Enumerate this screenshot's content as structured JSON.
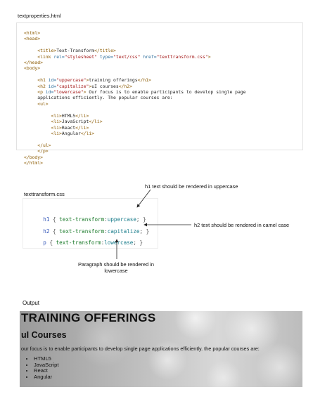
{
  "html_file": {
    "title": "textproperties.html",
    "lines": [
      {
        "indent": 0,
        "parts": [
          {
            "t": "<html>",
            "c": "tag"
          }
        ]
      },
      {
        "indent": 0,
        "parts": [
          {
            "t": "<head>",
            "c": "tag"
          }
        ]
      },
      {
        "indent": 0,
        "parts": [
          {
            "t": "",
            "c": "txt"
          }
        ]
      },
      {
        "indent": 5,
        "parts": [
          {
            "t": "<title>",
            "c": "tag"
          },
          {
            "t": "Text-Transform",
            "c": "txt"
          },
          {
            "t": "</title>",
            "c": "tag"
          }
        ]
      },
      {
        "indent": 5,
        "parts": [
          {
            "t": "<link ",
            "c": "tag"
          },
          {
            "t": "rel=",
            "c": "attr"
          },
          {
            "t": "\"stylesheet\"",
            "c": "str"
          },
          {
            "t": " type=",
            "c": "attr"
          },
          {
            "t": "\"text/css\"",
            "c": "str"
          },
          {
            "t": " href=",
            "c": "attr"
          },
          {
            "t": "\"texttransform.css\"",
            "c": "str"
          },
          {
            "t": ">",
            "c": "tag"
          }
        ]
      },
      {
        "indent": 0,
        "parts": [
          {
            "t": "</head>",
            "c": "tag"
          }
        ]
      },
      {
        "indent": 0,
        "parts": [
          {
            "t": "<body>",
            "c": "tag"
          }
        ]
      },
      {
        "indent": 0,
        "parts": [
          {
            "t": "",
            "c": "txt"
          }
        ]
      },
      {
        "indent": 5,
        "parts": [
          {
            "t": "<h1 ",
            "c": "tag"
          },
          {
            "t": "id=",
            "c": "attr"
          },
          {
            "t": "\"uppercase\"",
            "c": "str"
          },
          {
            "t": ">",
            "c": "tag"
          },
          {
            "t": "training offerings",
            "c": "txt"
          },
          {
            "t": "</h1>",
            "c": "tag"
          }
        ]
      },
      {
        "indent": 5,
        "parts": [
          {
            "t": "<h2 ",
            "c": "tag"
          },
          {
            "t": "id=",
            "c": "attr"
          },
          {
            "t": "\"capitalize\"",
            "c": "str"
          },
          {
            "t": ">",
            "c": "tag"
          },
          {
            "t": "uI courses",
            "c": "txt"
          },
          {
            "t": "</h2>",
            "c": "tag"
          }
        ]
      },
      {
        "indent": 5,
        "parts": [
          {
            "t": "<p ",
            "c": "tag"
          },
          {
            "t": "id=",
            "c": "attr"
          },
          {
            "t": "\"lowercase\"",
            "c": "str"
          },
          {
            "t": ">",
            "c": "tag"
          },
          {
            "t": " Our focus is to enable participants to develop single page",
            "c": "txt"
          }
        ]
      },
      {
        "indent": 5,
        "parts": [
          {
            "t": "applications efficiently. The popular courses are:",
            "c": "txt"
          }
        ]
      },
      {
        "indent": 5,
        "parts": [
          {
            "t": "<ul>",
            "c": "tag"
          }
        ]
      },
      {
        "indent": 0,
        "parts": [
          {
            "t": "",
            "c": "txt"
          }
        ]
      },
      {
        "indent": 10,
        "parts": [
          {
            "t": "<li>",
            "c": "tag"
          },
          {
            "t": "HTML5",
            "c": "txt"
          },
          {
            "t": "</li>",
            "c": "tag"
          }
        ]
      },
      {
        "indent": 10,
        "parts": [
          {
            "t": "<li>",
            "c": "tag"
          },
          {
            "t": "JavaScript",
            "c": "txt"
          },
          {
            "t": "</li>",
            "c": "tag"
          }
        ]
      },
      {
        "indent": 10,
        "parts": [
          {
            "t": "<li>",
            "c": "tag"
          },
          {
            "t": "React",
            "c": "txt"
          },
          {
            "t": "</li>",
            "c": "tag"
          }
        ]
      },
      {
        "indent": 10,
        "parts": [
          {
            "t": "<li>",
            "c": "tag"
          },
          {
            "t": "Angular",
            "c": "txt"
          },
          {
            "t": "</li>",
            "c": "tag"
          }
        ]
      },
      {
        "indent": 0,
        "parts": [
          {
            "t": "",
            "c": "txt"
          }
        ]
      },
      {
        "indent": 5,
        "parts": [
          {
            "t": "</ul>",
            "c": "tag"
          }
        ]
      },
      {
        "indent": 5,
        "parts": [
          {
            "t": "</p>",
            "c": "tag"
          }
        ]
      },
      {
        "indent": 0,
        "parts": [
          {
            "t": "</body>",
            "c": "tag"
          }
        ]
      },
      {
        "indent": 0,
        "parts": [
          {
            "t": "</html>",
            "c": "tag"
          }
        ]
      }
    ]
  },
  "css_file": {
    "title": "texttransform.css",
    "rules": [
      {
        "selector": "h1",
        "property": "text-transform",
        "value": "uppercase"
      },
      {
        "selector": "h2",
        "property": "text-transform",
        "value": "capitalize"
      },
      {
        "selector": "p",
        "property": "text-transform",
        "value": "lowercase"
      }
    ]
  },
  "annotations": {
    "h1_note": "h1 text should be rendered in uppercase",
    "h2_note": "h2 text should be rendered in camel case",
    "p_note_line1": "Paragraph should be rendered in",
    "p_note_line2": "lowercase"
  },
  "output": {
    "label": "Output",
    "h1": "training offerings",
    "h2": "uI courses",
    "paragraph": "Our focus is to enable participants to develop single page applications efficiently. The popular courses are:",
    "list": [
      "HTML5",
      "JavaScript",
      "React",
      "Angular"
    ]
  },
  "colors": {
    "tag": "#8b5a00",
    "attribute": "#2d6e9c",
    "string": "#a31515",
    "selector": "#2b4fb5",
    "property": "#1a7a2a",
    "value": "#177b8a"
  }
}
